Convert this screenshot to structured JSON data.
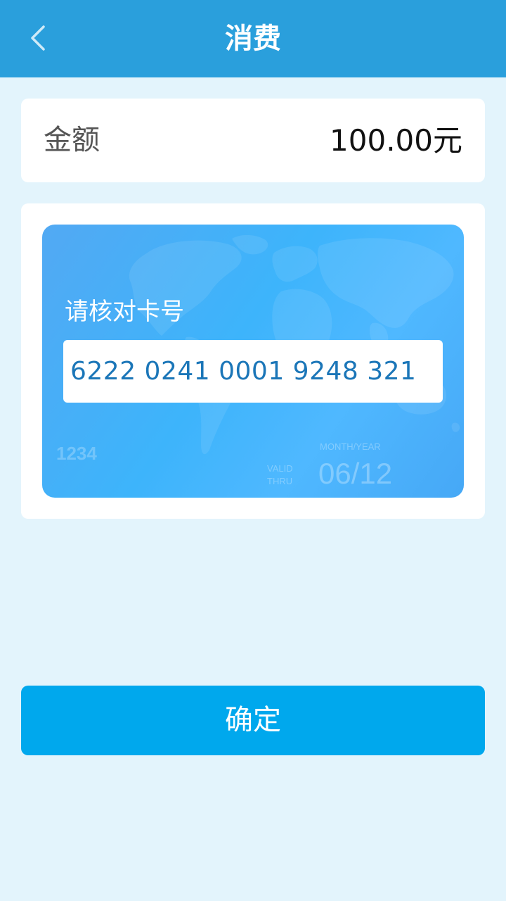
{
  "header": {
    "title": "消费",
    "back_icon": "chevron-left-icon"
  },
  "amount": {
    "label": "金额",
    "value": "100.00元"
  },
  "card": {
    "verify_label": "请核对卡号",
    "number": "6222 0241 0001 9248 321",
    "last4": "1234",
    "month_year_label": "MONTH/YEAR",
    "valid_label_1": "VALID",
    "valid_label_2": "THRU",
    "expiry": "06/12"
  },
  "confirm": {
    "label": "确定"
  },
  "colors": {
    "header": "#2a9fdc",
    "background": "#e3f4fc",
    "button": "#00a8ed",
    "card_number": "#1b76b8"
  }
}
